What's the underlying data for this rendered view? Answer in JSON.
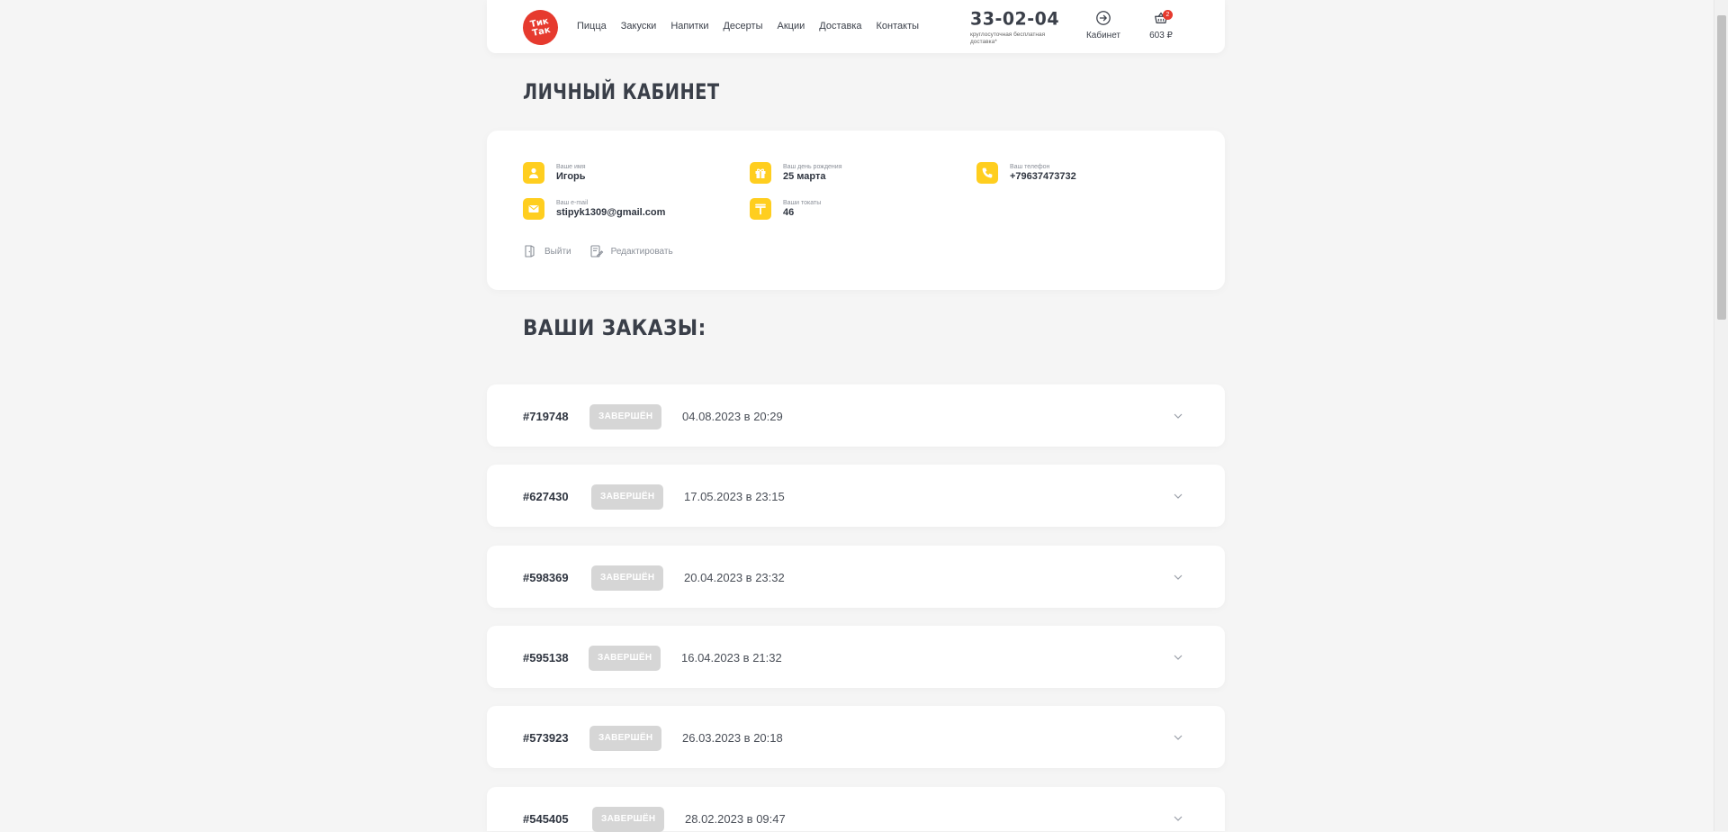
{
  "header": {
    "logo_text": "Тик Так",
    "nav": [
      "Пицца",
      "Закуски",
      "Напитки",
      "Десерты",
      "Акции",
      "Доставка",
      "Контакты"
    ],
    "phone": "33-02-04",
    "phone_note": "круглосуточная бесплатная доставка*",
    "cabinet_label": "Кабинет",
    "cart_count": "2",
    "cart_total": "603 ₽"
  },
  "page_title": "ЛИЧНЫЙ КАБИНЕТ",
  "profile": {
    "name_label": "Ваше имя",
    "name": "Игорь",
    "birthday_label": "Ваш день рождения",
    "birthday": "25 марта",
    "phone_label": "Ваш телефон",
    "phone": "+79637473732",
    "email_label": "Ваш e-mail",
    "email": "stipyk1309@gmail.com",
    "tokens_label": "Ваши токаты",
    "tokens": "46",
    "logout": "Выйти",
    "edit": "Редактировать"
  },
  "orders_title": "ВАШИ ЗАКАЗЫ:",
  "orders": [
    {
      "num": "#719748",
      "status": "ЗАВЕРШЁН",
      "date": "04.08.2023 в 20:29"
    },
    {
      "num": "#627430",
      "status": "ЗАВЕРШЁН",
      "date": "17.05.2023 в 23:15"
    },
    {
      "num": "#598369",
      "status": "ЗАВЕРШЁН",
      "date": "20.04.2023 в 23:32"
    },
    {
      "num": "#595138",
      "status": "ЗАВЕРШЁН",
      "date": "16.04.2023 в 21:32"
    },
    {
      "num": "#573923",
      "status": "ЗАВЕРШЁН",
      "date": "26.03.2023 в 20:18"
    },
    {
      "num": "#545405",
      "status": "ЗАВЕРШЁН",
      "date": "28.02.2023 в 09:47"
    }
  ],
  "colors": {
    "accent_yellow": "#ffce1f",
    "brand_red": "#e63a2e",
    "status_gray": "#d6d6d6"
  }
}
